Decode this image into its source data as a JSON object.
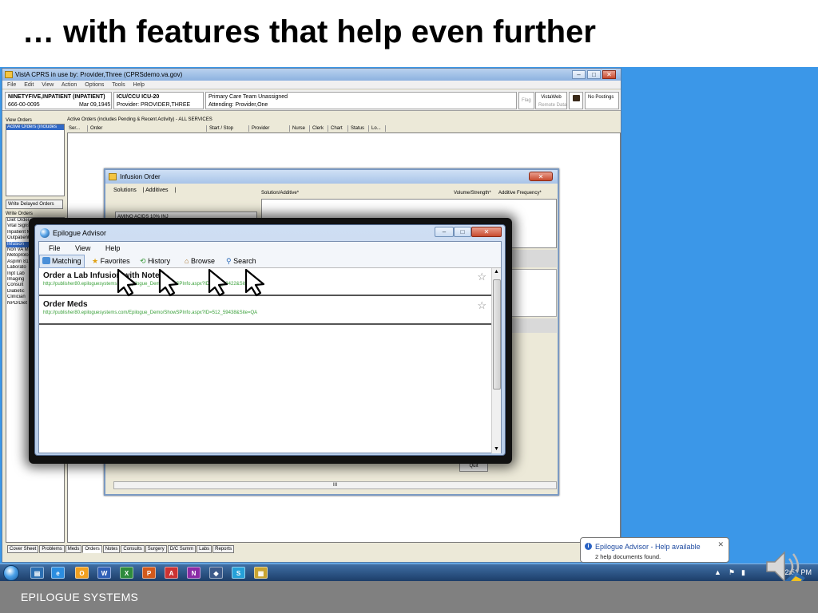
{
  "slide": {
    "title": "… with features that help even further",
    "footer": "EPILOGUE SYSTEMS"
  },
  "cprs": {
    "window_title": "VistA CPRS in use by: Provider,Three  (CPRSdemo.va.gov)",
    "menu": [
      "File",
      "Edit",
      "View",
      "Action",
      "Options",
      "Tools",
      "Help"
    ],
    "patient": {
      "name": "NINETYFIVE,INPATIENT (INPATIENT)",
      "ssn": "666-00-0095",
      "dob": "Mar 09,1945 (66)",
      "location": "ICU/CCU ICU-20",
      "provider": "Provider:  PROVIDER,THREE",
      "primary_care": "Primary Care Team Unassigned",
      "attending": "Attending:  Provider,One",
      "flag": "Flag",
      "vistaweb": "VistaWeb",
      "remote_data": "Remote Data",
      "postings": "No Postings"
    },
    "view_orders_label": "View Orders",
    "view_orders_selected": "Active Orders (includes",
    "write_delayed": "Write Delayed Orders",
    "write_orders_label": "Write Orders",
    "write_orders": [
      "Diet Order",
      "Vital Signs",
      "Inpatient Medications",
      "Outpatient Medications",
      "Infusion",
      "Non VA Meds",
      "Metoprolol Tartrate 50r",
      "Aspirin 81 MG Non Va",
      "Laborato",
      "Inpt Lab",
      "Imaging",
      "Consult",
      "Diabetic",
      "Clinician",
      "NPD/Diet"
    ],
    "orders_caption": "Active Orders (includes Pending & Recent Activity) - ALL SERVICES",
    "columns": [
      "Ser...",
      "Order",
      "Start / Stop",
      "Provider",
      "Nurse",
      "Clerk",
      "Chart",
      "Status",
      "Lo..."
    ],
    "tabs": [
      "Cover Sheet",
      "Problems",
      "Meds",
      "Orders",
      "Notes",
      "Consults",
      "Surgery",
      "D/C Summ",
      "Labs",
      "Reports"
    ],
    "active_tab": "Orders"
  },
  "infusion": {
    "title": "Infusion Order",
    "tabs": [
      "Solutions",
      "Additives"
    ],
    "hdr_solution": "Solution/Additive*",
    "hdr_volume": "Volume/Strength*",
    "hdr_freq": "Additive Frequency*",
    "list_item": "AMINO ACIDS 10% INJ",
    "quit": "Quit",
    "hscroll": "III"
  },
  "epilogue": {
    "title": "Epilogue Advisor",
    "menu": [
      "File",
      "View",
      "Help"
    ],
    "toolbar": {
      "matching": "Matching",
      "favorites": "Favorites",
      "history": "History",
      "browse": "Browse",
      "search": "Search"
    },
    "results": [
      {
        "title": "Order a Lab Infusion with Note",
        "url": "http://publisher80.epiloguesystems.com/Epilogue_Demo/ShowSPInfo.aspx?ID=509_58422&Site=QA"
      },
      {
        "title": "Order Meds",
        "url": "http://publisher80.epiloguesystems.com/Epilogue_Demo/ShowSPInfo.aspx?ID=512_59438&Site=QA"
      }
    ]
  },
  "balloon": {
    "title": "Epilogue Advisor - Help available",
    "message": "2 help documents found."
  },
  "taskbar": {
    "clock": "12:52 PM"
  },
  "colors": {
    "desktop": "#3b97e8",
    "footer": "#808080",
    "url_green": "#3aa03a",
    "selection": "#3169c6"
  }
}
